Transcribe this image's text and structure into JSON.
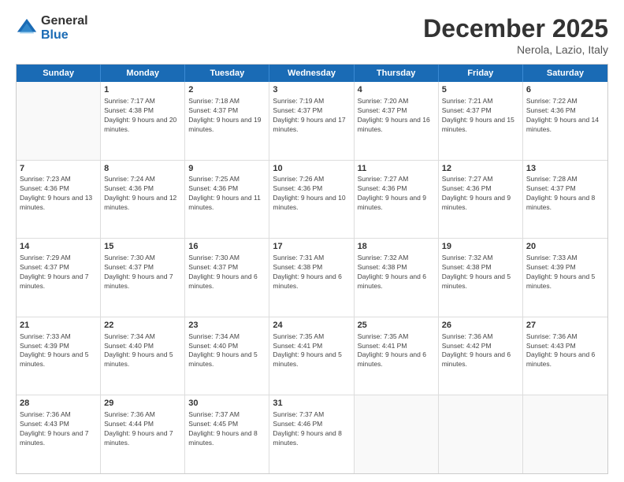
{
  "logo": {
    "general": "General",
    "blue": "Blue"
  },
  "title": {
    "month": "December 2025",
    "location": "Nerola, Lazio, Italy"
  },
  "header_days": [
    "Sunday",
    "Monday",
    "Tuesday",
    "Wednesday",
    "Thursday",
    "Friday",
    "Saturday"
  ],
  "rows": [
    [
      {
        "day": "",
        "sunrise": "",
        "sunset": "",
        "daylight": ""
      },
      {
        "day": "1",
        "sunrise": "Sunrise: 7:17 AM",
        "sunset": "Sunset: 4:38 PM",
        "daylight": "Daylight: 9 hours and 20 minutes."
      },
      {
        "day": "2",
        "sunrise": "Sunrise: 7:18 AM",
        "sunset": "Sunset: 4:37 PM",
        "daylight": "Daylight: 9 hours and 19 minutes."
      },
      {
        "day": "3",
        "sunrise": "Sunrise: 7:19 AM",
        "sunset": "Sunset: 4:37 PM",
        "daylight": "Daylight: 9 hours and 17 minutes."
      },
      {
        "day": "4",
        "sunrise": "Sunrise: 7:20 AM",
        "sunset": "Sunset: 4:37 PM",
        "daylight": "Daylight: 9 hours and 16 minutes."
      },
      {
        "day": "5",
        "sunrise": "Sunrise: 7:21 AM",
        "sunset": "Sunset: 4:37 PM",
        "daylight": "Daylight: 9 hours and 15 minutes."
      },
      {
        "day": "6",
        "sunrise": "Sunrise: 7:22 AM",
        "sunset": "Sunset: 4:36 PM",
        "daylight": "Daylight: 9 hours and 14 minutes."
      }
    ],
    [
      {
        "day": "7",
        "sunrise": "Sunrise: 7:23 AM",
        "sunset": "Sunset: 4:36 PM",
        "daylight": "Daylight: 9 hours and 13 minutes."
      },
      {
        "day": "8",
        "sunrise": "Sunrise: 7:24 AM",
        "sunset": "Sunset: 4:36 PM",
        "daylight": "Daylight: 9 hours and 12 minutes."
      },
      {
        "day": "9",
        "sunrise": "Sunrise: 7:25 AM",
        "sunset": "Sunset: 4:36 PM",
        "daylight": "Daylight: 9 hours and 11 minutes."
      },
      {
        "day": "10",
        "sunrise": "Sunrise: 7:26 AM",
        "sunset": "Sunset: 4:36 PM",
        "daylight": "Daylight: 9 hours and 10 minutes."
      },
      {
        "day": "11",
        "sunrise": "Sunrise: 7:27 AM",
        "sunset": "Sunset: 4:36 PM",
        "daylight": "Daylight: 9 hours and 9 minutes."
      },
      {
        "day": "12",
        "sunrise": "Sunrise: 7:27 AM",
        "sunset": "Sunset: 4:36 PM",
        "daylight": "Daylight: 9 hours and 9 minutes."
      },
      {
        "day": "13",
        "sunrise": "Sunrise: 7:28 AM",
        "sunset": "Sunset: 4:37 PM",
        "daylight": "Daylight: 9 hours and 8 minutes."
      }
    ],
    [
      {
        "day": "14",
        "sunrise": "Sunrise: 7:29 AM",
        "sunset": "Sunset: 4:37 PM",
        "daylight": "Daylight: 9 hours and 7 minutes."
      },
      {
        "day": "15",
        "sunrise": "Sunrise: 7:30 AM",
        "sunset": "Sunset: 4:37 PM",
        "daylight": "Daylight: 9 hours and 7 minutes."
      },
      {
        "day": "16",
        "sunrise": "Sunrise: 7:30 AM",
        "sunset": "Sunset: 4:37 PM",
        "daylight": "Daylight: 9 hours and 6 minutes."
      },
      {
        "day": "17",
        "sunrise": "Sunrise: 7:31 AM",
        "sunset": "Sunset: 4:38 PM",
        "daylight": "Daylight: 9 hours and 6 minutes."
      },
      {
        "day": "18",
        "sunrise": "Sunrise: 7:32 AM",
        "sunset": "Sunset: 4:38 PM",
        "daylight": "Daylight: 9 hours and 6 minutes."
      },
      {
        "day": "19",
        "sunrise": "Sunrise: 7:32 AM",
        "sunset": "Sunset: 4:38 PM",
        "daylight": "Daylight: 9 hours and 5 minutes."
      },
      {
        "day": "20",
        "sunrise": "Sunrise: 7:33 AM",
        "sunset": "Sunset: 4:39 PM",
        "daylight": "Daylight: 9 hours and 5 minutes."
      }
    ],
    [
      {
        "day": "21",
        "sunrise": "Sunrise: 7:33 AM",
        "sunset": "Sunset: 4:39 PM",
        "daylight": "Daylight: 9 hours and 5 minutes."
      },
      {
        "day": "22",
        "sunrise": "Sunrise: 7:34 AM",
        "sunset": "Sunset: 4:40 PM",
        "daylight": "Daylight: 9 hours and 5 minutes."
      },
      {
        "day": "23",
        "sunrise": "Sunrise: 7:34 AM",
        "sunset": "Sunset: 4:40 PM",
        "daylight": "Daylight: 9 hours and 5 minutes."
      },
      {
        "day": "24",
        "sunrise": "Sunrise: 7:35 AM",
        "sunset": "Sunset: 4:41 PM",
        "daylight": "Daylight: 9 hours and 5 minutes."
      },
      {
        "day": "25",
        "sunrise": "Sunrise: 7:35 AM",
        "sunset": "Sunset: 4:41 PM",
        "daylight": "Daylight: 9 hours and 6 minutes."
      },
      {
        "day": "26",
        "sunrise": "Sunrise: 7:36 AM",
        "sunset": "Sunset: 4:42 PM",
        "daylight": "Daylight: 9 hours and 6 minutes."
      },
      {
        "day": "27",
        "sunrise": "Sunrise: 7:36 AM",
        "sunset": "Sunset: 4:43 PM",
        "daylight": "Daylight: 9 hours and 6 minutes."
      }
    ],
    [
      {
        "day": "28",
        "sunrise": "Sunrise: 7:36 AM",
        "sunset": "Sunset: 4:43 PM",
        "daylight": "Daylight: 9 hours and 7 minutes."
      },
      {
        "day": "29",
        "sunrise": "Sunrise: 7:36 AM",
        "sunset": "Sunset: 4:44 PM",
        "daylight": "Daylight: 9 hours and 7 minutes."
      },
      {
        "day": "30",
        "sunrise": "Sunrise: 7:37 AM",
        "sunset": "Sunset: 4:45 PM",
        "daylight": "Daylight: 9 hours and 8 minutes."
      },
      {
        "day": "31",
        "sunrise": "Sunrise: 7:37 AM",
        "sunset": "Sunset: 4:46 PM",
        "daylight": "Daylight: 9 hours and 8 minutes."
      },
      {
        "day": "",
        "sunrise": "",
        "sunset": "",
        "daylight": ""
      },
      {
        "day": "",
        "sunrise": "",
        "sunset": "",
        "daylight": ""
      },
      {
        "day": "",
        "sunrise": "",
        "sunset": "",
        "daylight": ""
      }
    ]
  ]
}
